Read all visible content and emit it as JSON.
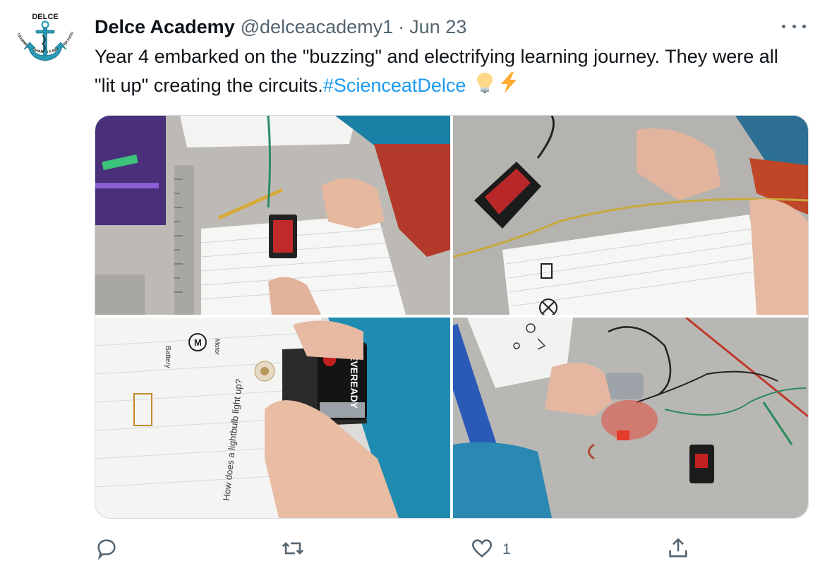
{
  "author": {
    "name": "Delce Academy",
    "handle": "@delceacademy1",
    "separator": "·",
    "date": "Jun 23",
    "avatar_text_top": "DELCE",
    "avatar_text_ring": "LEARNING TOWARDS A BRIGHTER FUTURE"
  },
  "tweet": {
    "text": "Year 4 embarked on the \"buzzing\" and electrifying  learning journey. They were all \"lit up\" creating the circuits.",
    "hashtag": "#ScienceatDelce",
    "emojis": [
      "lightbulb-emoji",
      "lightning-emoji"
    ]
  },
  "media": {
    "photos": [
      {
        "subject": "battery-holder-on-worksheet"
      },
      {
        "subject": "battery-with-yellow-wire"
      },
      {
        "subject": "hands-holding-eveready-battery",
        "battery_text": "EVEREADY",
        "sheet_labels": {
          "battery": "Battery",
          "motor": "Motor",
          "motor_symbol": "M",
          "question": "How does a lightbulb light up?"
        }
      },
      {
        "subject": "motor-buzzer-and-red-led"
      }
    ]
  },
  "actions": {
    "reply": {
      "icon": "reply-icon",
      "count": ""
    },
    "retweet": {
      "icon": "retweet-icon",
      "count": ""
    },
    "like": {
      "icon": "heart-icon",
      "count": "1"
    },
    "share": {
      "icon": "share-icon",
      "count": ""
    }
  },
  "colors": {
    "link": "#1d9bf0",
    "secondary": "#536471",
    "primary": "#0f1419",
    "anchor": "#2a9bb7"
  }
}
